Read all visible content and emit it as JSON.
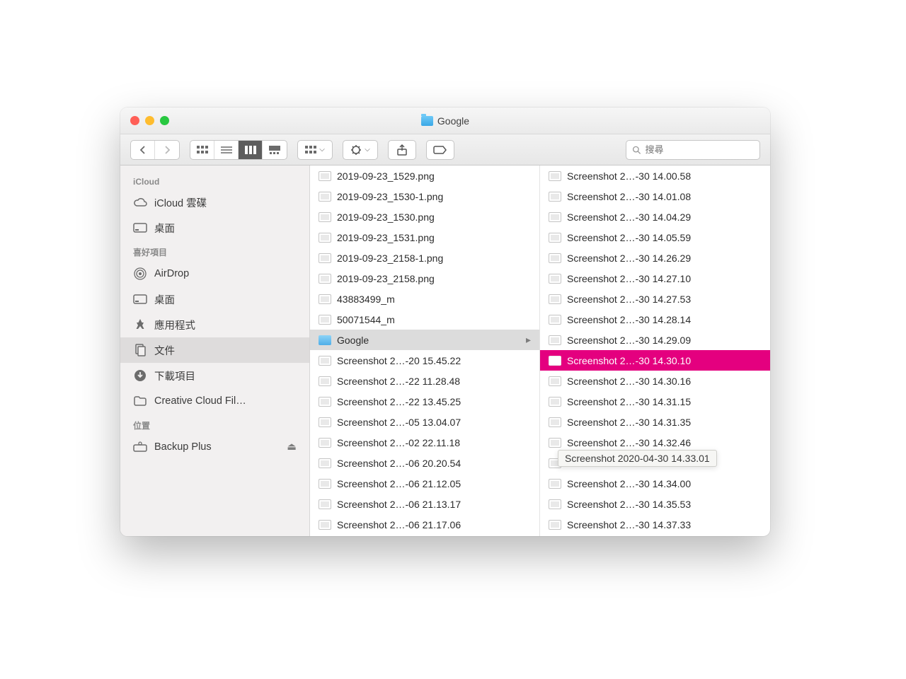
{
  "window": {
    "title": "Google"
  },
  "toolbar": {
    "search_placeholder": "搜尋"
  },
  "sidebar": {
    "sections": [
      {
        "heading": "iCloud",
        "items": [
          {
            "label": "iCloud 雲碟",
            "icon": "cloud"
          },
          {
            "label": "桌面",
            "icon": "desktop"
          }
        ]
      },
      {
        "heading": "喜好項目",
        "items": [
          {
            "label": "AirDrop",
            "icon": "airdrop"
          },
          {
            "label": "桌面",
            "icon": "desktop"
          },
          {
            "label": "應用程式",
            "icon": "apps"
          },
          {
            "label": "文件",
            "icon": "documents",
            "selected": true
          },
          {
            "label": "下載項目",
            "icon": "downloads"
          },
          {
            "label": "Creative Cloud Fil…",
            "icon": "folder"
          }
        ]
      },
      {
        "heading": "位置",
        "items": [
          {
            "label": "Backup Plus",
            "icon": "drive",
            "eject": true
          }
        ]
      }
    ]
  },
  "column1": [
    {
      "label": "2019-09-23_1529.png"
    },
    {
      "label": "2019-09-23_1530-1.png"
    },
    {
      "label": "2019-09-23_1530.png"
    },
    {
      "label": "2019-09-23_1531.png"
    },
    {
      "label": "2019-09-23_2158-1.png"
    },
    {
      "label": "2019-09-23_2158.png"
    },
    {
      "label": "43883499_m"
    },
    {
      "label": "50071544_m"
    },
    {
      "label": "Google",
      "folder": true
    },
    {
      "label": "Screenshot 2…-20 15.45.22"
    },
    {
      "label": "Screenshot 2…-22 11.28.48"
    },
    {
      "label": "Screenshot 2…-22 13.45.25"
    },
    {
      "label": "Screenshot 2…-05 13.04.07"
    },
    {
      "label": "Screenshot 2…-02 22.11.18"
    },
    {
      "label": "Screenshot 2…-06 20.20.54"
    },
    {
      "label": "Screenshot 2…-06 21.12.05"
    },
    {
      "label": "Screenshot 2…-06 21.13.17"
    },
    {
      "label": "Screenshot 2…-06 21.17.06"
    }
  ],
  "column2": [
    {
      "label": "Screenshot 2…-30 14.00.58"
    },
    {
      "label": "Screenshot 2…-30 14.01.08"
    },
    {
      "label": "Screenshot 2…-30 14.04.29"
    },
    {
      "label": "Screenshot 2…-30 14.05.59"
    },
    {
      "label": "Screenshot 2…-30 14.26.29"
    },
    {
      "label": "Screenshot 2…-30 14.27.10"
    },
    {
      "label": "Screenshot 2…-30 14.27.53"
    },
    {
      "label": "Screenshot 2…-30 14.28.14"
    },
    {
      "label": "Screenshot 2…-30 14.29.09"
    },
    {
      "label": "Screenshot 2…-30 14.30.10",
      "selected": true
    },
    {
      "label": "Screenshot 2…-30 14.30.16"
    },
    {
      "label": "Screenshot 2…-30 14.31.15"
    },
    {
      "label": "Screenshot 2…-30 14.31.35"
    },
    {
      "label": "Screenshot 2…-30 14.32.46"
    },
    {
      "label": "Screenshot 2…-30 14.33.01"
    },
    {
      "label": "Screenshot 2…-30 14.34.00"
    },
    {
      "label": "Screenshot 2…-30 14.35.53"
    },
    {
      "label": "Screenshot 2…-30 14.37.33"
    }
  ],
  "tooltip": "Screenshot 2020-04-30 14.33.01"
}
